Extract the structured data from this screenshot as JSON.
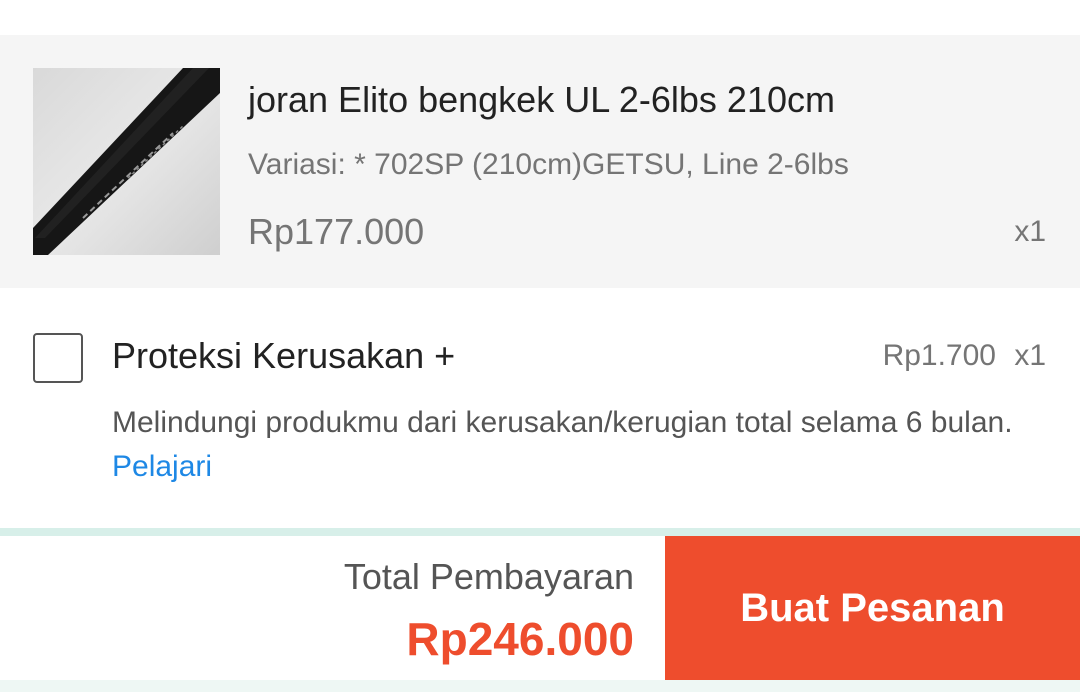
{
  "product": {
    "image_icon": "fishing-rod-photo",
    "title": "joran Elito bengkek UL 2-6lbs 210cm",
    "variant": "Variasi: * 702SP (210cm)GETSU, Line 2-6lbs",
    "price": "Rp177.000",
    "quantity": "x1"
  },
  "protection": {
    "checked": false,
    "title": "Proteksi Kerusakan +",
    "price": "Rp1.700",
    "quantity": "x1",
    "description": "Melindungi produkmu dari kerusakan/kerugian total selama 6 bulan.",
    "link_label": "Pelajari",
    "link_color": "#1e88e5"
  },
  "footer": {
    "total_label": "Total Pembayaran",
    "total_amount": "Rp246.000",
    "order_button_label": "Buat Pesanan",
    "accent_color": "#ee4d2d"
  }
}
